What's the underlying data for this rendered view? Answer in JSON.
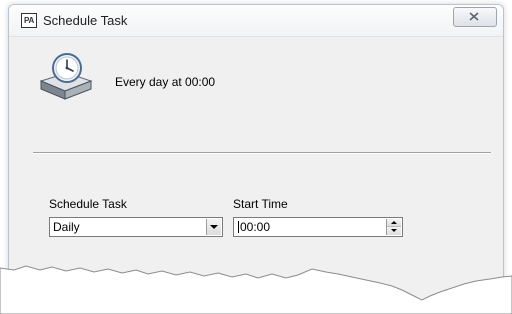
{
  "window": {
    "title": "Schedule Task",
    "app_icon_text": "PA"
  },
  "summary": {
    "text": "Every day at 00:00",
    "icon": "scheduled-task-clock-icon"
  },
  "form": {
    "schedule_label": "Schedule Task",
    "schedule_value": "Daily",
    "start_time_label": "Start Time",
    "start_time_value": "00:00"
  },
  "icons": {
    "close": "close-icon",
    "dropdown": "chevron-down-icon",
    "spin_up": "spin-up-icon",
    "spin_down": "spin-down-icon"
  },
  "colors": {
    "window_bg": "#f0f0f0",
    "titlebar_bg": "#f6f7f9",
    "border": "#b9c4cf"
  }
}
